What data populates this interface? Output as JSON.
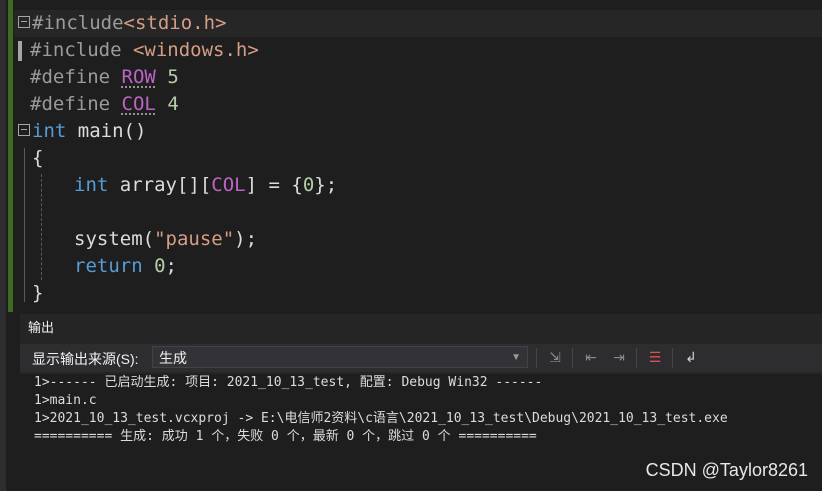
{
  "editor": {
    "lines": [
      {
        "directive": "#include",
        "header": "<stdio.h>"
      },
      {
        "directive": "#include",
        "header": " <windows.h>"
      },
      {
        "directive": "#define",
        "name": "ROW",
        "value": "5"
      },
      {
        "directive": "#define",
        "name": "COL",
        "value": "4"
      },
      {
        "type": "int",
        "func": " main()"
      },
      {
        "text": "{"
      },
      {
        "type": "int",
        "decl": " array[][",
        "macro": "COL",
        "rest": "] = {",
        "num": "0",
        "end": "};"
      },
      {
        "text": ""
      },
      {
        "call": "system(",
        "arg": "\"pause\"",
        "end": ");"
      },
      {
        "kw": "return",
        "num": " 0",
        "end": ";"
      },
      {
        "text": "}"
      }
    ]
  },
  "panel": {
    "title": "输出",
    "source_label": "显示输出来源(S):",
    "source_value": "生成",
    "output_lines": [
      "1>------ 已启动生成: 项目: 2021_10_13_test, 配置: Debug Win32 ------",
      "1>main.c",
      "1>2021_10_13_test.vcxproj -> E:\\电信师2资料\\c语言\\2021_10_13_test\\Debug\\2021_10_13_test.exe",
      "========== 生成: 成功 1 个，失败 0 个，最新 0 个，跳过 0 个 =========="
    ]
  },
  "toolbar": {
    "icons": [
      "find-message-icon",
      "previous-message-icon",
      "next-message-icon",
      "clear-all-icon",
      "word-wrap-icon"
    ]
  },
  "watermark": "CSDN @Taylor8261",
  "colors": {
    "keyword": "#569cd6",
    "string": "#d69d85",
    "number": "#b5cea8",
    "macro": "#bd63c5",
    "preprocessor": "#9b9b9b"
  }
}
